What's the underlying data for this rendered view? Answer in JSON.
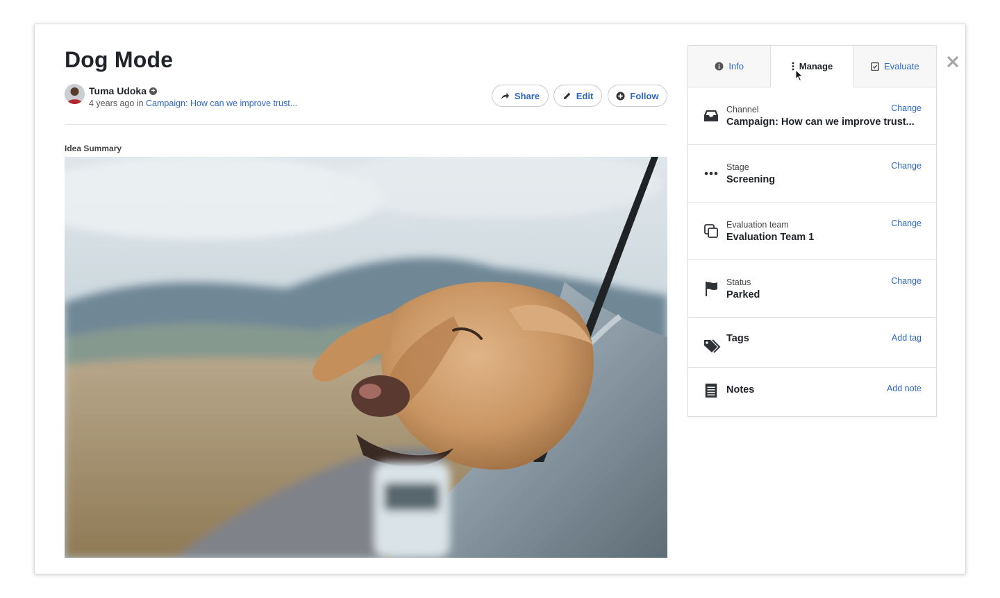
{
  "idea": {
    "title": "Dog Mode",
    "author": "Tuma Udoka",
    "time_ago": "4 years ago",
    "in_word": "in",
    "campaign": "Campaign: How can we improve trust...",
    "summary_label": "Idea Summary"
  },
  "actions": {
    "share": "Share",
    "edit": "Edit",
    "follow": "Follow"
  },
  "tabs": {
    "info": "Info",
    "manage": "Manage",
    "evaluate": "Evaluate",
    "active": "Manage"
  },
  "manage": {
    "channel": {
      "label": "Channel",
      "value": "Campaign: How can we improve trust...",
      "action": "Change"
    },
    "stage": {
      "label": "Stage",
      "value": "Screening",
      "action": "Change"
    },
    "evaluation_team": {
      "label": "Evaluation team",
      "value": "Evaluation Team 1",
      "action": "Change"
    },
    "status": {
      "label": "Status",
      "value": "Parked",
      "action": "Change"
    },
    "tags": {
      "label": "Tags",
      "action": "Add tag"
    },
    "notes": {
      "label": "Notes",
      "action": "Add note"
    }
  },
  "icons": {
    "close": "close-icon",
    "prev": "chevron-left-icon",
    "next": "chevron-right-icon",
    "share": "share-arrow-icon",
    "edit": "pencil-icon",
    "follow": "plus-circle-icon",
    "info": "info-icon",
    "manage": "kebab-icon",
    "evaluate": "clipboard-check-icon",
    "channel": "inbox-icon",
    "stage": "ellipsis-icon",
    "evaluation_team": "copy-icon",
    "status": "flag-icon",
    "tags": "tags-icon",
    "notes": "notes-icon"
  },
  "colors": {
    "link": "#2d68c4",
    "text": "#1f2328",
    "border": "#dedede"
  }
}
